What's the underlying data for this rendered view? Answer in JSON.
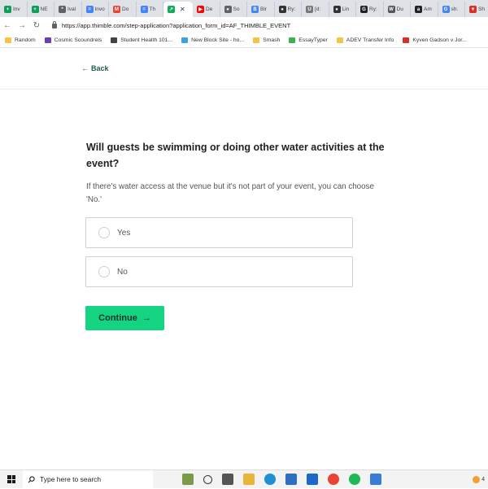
{
  "browser": {
    "tabs": [
      {
        "label": "Inv",
        "color": "#0f9d58",
        "glyph": "+"
      },
      {
        "label": "NE",
        "color": "#0f9d58",
        "glyph": "+"
      },
      {
        "label": "Ival",
        "color": "#5f6368",
        "glyph": "*"
      },
      {
        "label": "Invo",
        "color": "#4285f4",
        "glyph": "="
      },
      {
        "label": "Do",
        "color": "#ea4335",
        "glyph": "M"
      },
      {
        "label": "Th",
        "color": "#4285f4",
        "glyph": "="
      },
      {
        "label": "",
        "color": "#15a95a",
        "glyph": "↗",
        "active": true
      },
      {
        "label": "De",
        "color": "#ff0000",
        "glyph": "▶"
      },
      {
        "label": "So",
        "color": "#5f6368",
        "glyph": "●"
      },
      {
        "label": "Bir",
        "color": "#4285f4",
        "glyph": "B"
      },
      {
        "label": "Ry:",
        "color": "#333333",
        "glyph": "●"
      },
      {
        "label": "[d:",
        "color": "#777777",
        "glyph": "U"
      },
      {
        "label": "Lin",
        "color": "#333333",
        "glyph": "●"
      },
      {
        "label": "Ry:",
        "color": "#222222",
        "glyph": "G"
      },
      {
        "label": "Du",
        "color": "#555555",
        "glyph": "W"
      },
      {
        "label": "Am",
        "color": "#222222",
        "glyph": "a"
      },
      {
        "label": "sh:",
        "color": "#4285f4",
        "glyph": "G"
      },
      {
        "label": "Sh",
        "color": "#d93025",
        "glyph": "▼"
      }
    ],
    "nav": {
      "back": "←",
      "forward": "→",
      "reload": "↻"
    },
    "url": "https://app.thimble.com/step-application?application_form_id=AF_THIMBLE_EVENT",
    "bookmarks": [
      {
        "label": "Random",
        "color": "#f6c343"
      },
      {
        "label": "Cosmic Scoundrels",
        "color": "#6a3fb5"
      },
      {
        "label": "Student Health 101...",
        "color": "#444444"
      },
      {
        "label": "New Block Site - ho...",
        "color": "#3aa3e3"
      },
      {
        "label": "Smash",
        "color": "#f6c343"
      },
      {
        "label": "EssayTyper",
        "color": "#3bb34a"
      },
      {
        "label": "ADEV Transfer Info",
        "color": "#f6c343"
      },
      {
        "label": "Kyven Gadson v Jor...",
        "color": "#d93025"
      }
    ]
  },
  "page": {
    "back_label": "Back",
    "back_arrow": "←",
    "question": "Will guests be swimming or doing other water activities at the event?",
    "hint": "If there's water access at the venue but it's not part of your event, you can choose 'No.'",
    "options": [
      {
        "label": "Yes"
      },
      {
        "label": "No"
      }
    ],
    "continue_label": "Continue",
    "continue_arrow": "→",
    "accent": "#15d481"
  },
  "taskbar": {
    "search_placeholder": "Type here to search",
    "tray_text": "4"
  }
}
